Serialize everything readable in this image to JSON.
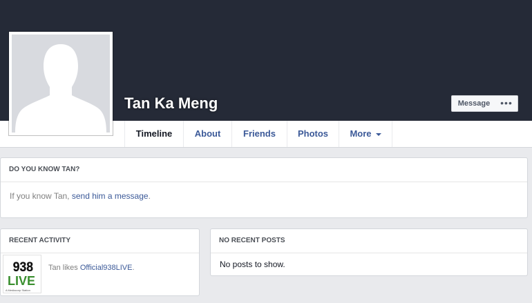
{
  "profile": {
    "name": "Tan Ka Meng",
    "message_button": "Message",
    "more_button": "•••"
  },
  "tabs": [
    {
      "label": "Timeline",
      "active": true
    },
    {
      "label": "About",
      "active": false
    },
    {
      "label": "Friends",
      "active": false
    },
    {
      "label": "Photos",
      "active": false
    },
    {
      "label": "More",
      "active": false
    }
  ],
  "know_card": {
    "title": "DO YOU KNOW TAN?",
    "prefix": "If you know Tan, ",
    "link": "send him a message",
    "suffix": "."
  },
  "activity_card": {
    "title": "RECENT ACTIVITY",
    "prefix": "Tan likes ",
    "link": "Official938LIVE",
    "suffix": ".",
    "logo": {
      "number": "938",
      "word": "LIVE",
      "tagline": "A Mediacorp Station"
    }
  },
  "posts_card": {
    "title": "NO RECENT POSTS",
    "body": "No posts to show."
  },
  "colors": {
    "cover": "#252a37",
    "link": "#3b5998",
    "page_bg": "#e9eaed",
    "logo_green": "#3a8f2f"
  }
}
